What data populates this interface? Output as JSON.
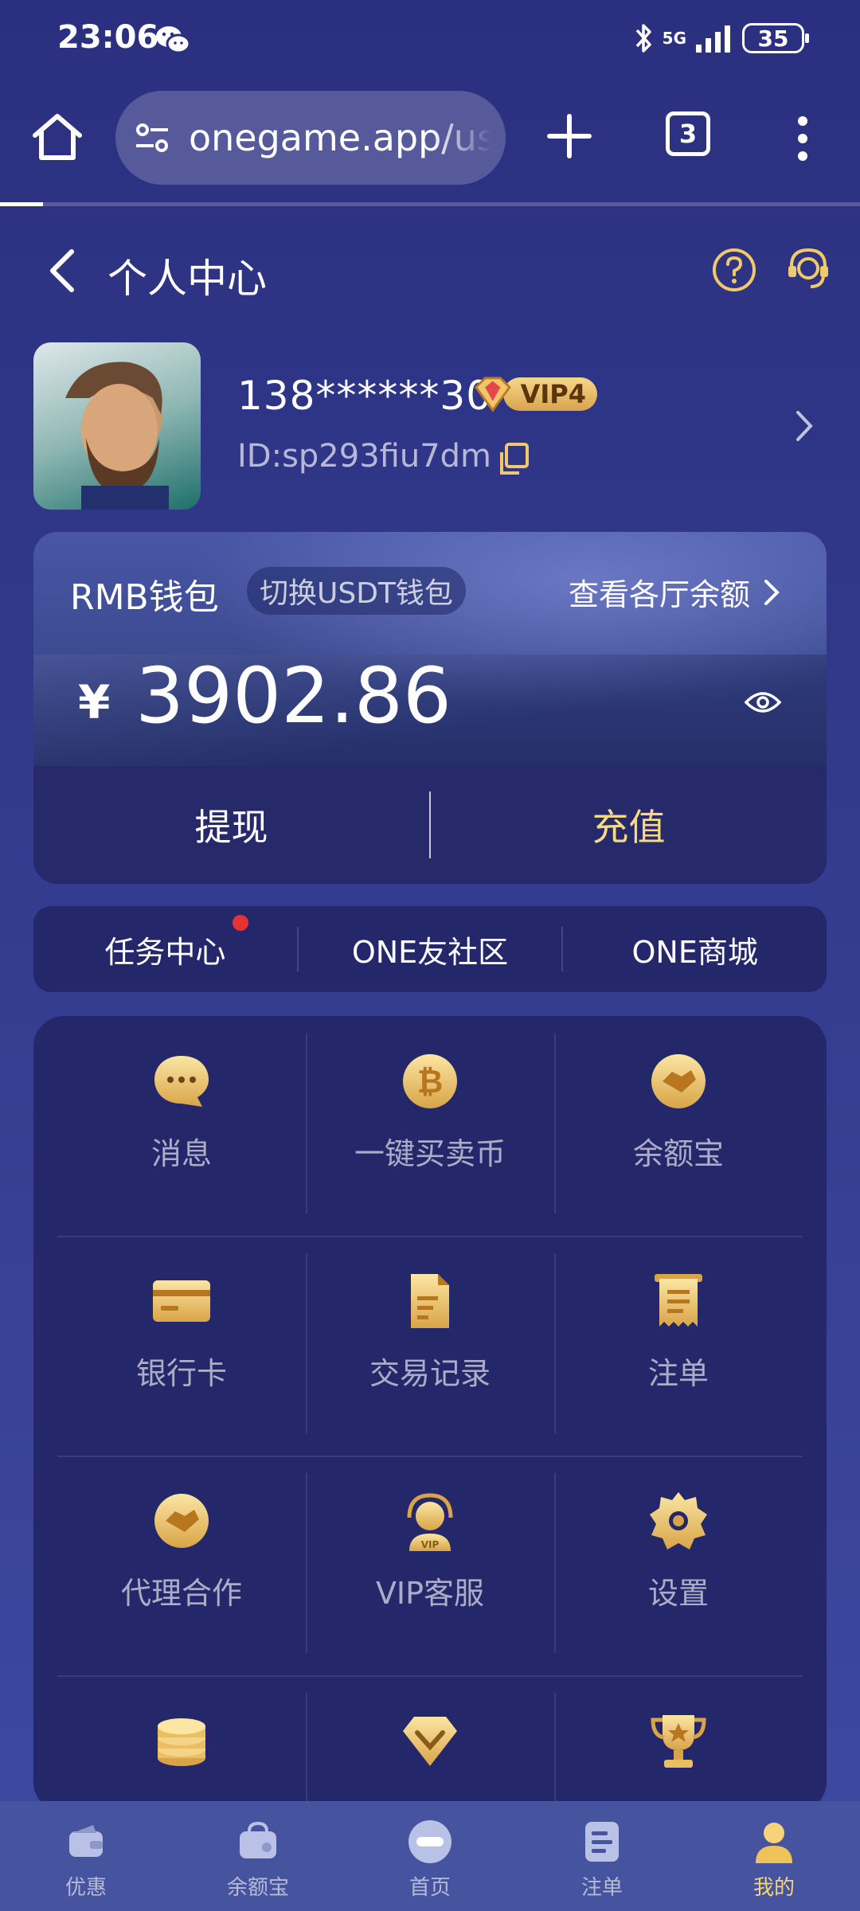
{
  "status_bar": {
    "time": "23:06",
    "network": "5G",
    "battery": "35"
  },
  "browser": {
    "url": "onegame.app/us",
    "tab_count": "3",
    "load_progress": 0.05
  },
  "header": {
    "title": "个人中心"
  },
  "profile": {
    "phone": "138******30",
    "vip_level": "VIP4",
    "user_id": "ID:sp293fiu7dm"
  },
  "wallet": {
    "name": "RMB钱包",
    "switch_label": "切换USDT钱包",
    "view_all_label": "查看各厅余额",
    "currency_symbol": "¥",
    "balance": "3902.86",
    "withdraw_label": "提现",
    "recharge_label": "充值"
  },
  "quick_links": [
    {
      "label": "任务中心",
      "has_dot": true
    },
    {
      "label": "ONE友社区"
    },
    {
      "label": "ONE商城"
    }
  ],
  "grid": [
    {
      "label": "消息",
      "icon": "message-icon"
    },
    {
      "label": "一键买卖币",
      "icon": "bitcoin-icon"
    },
    {
      "label": "余额宝",
      "icon": "handshake-icon"
    },
    {
      "label": "银行卡",
      "icon": "bank-card-icon"
    },
    {
      "label": "交易记录",
      "icon": "document-icon"
    },
    {
      "label": "注单",
      "icon": "receipt-icon"
    },
    {
      "label": "代理合作",
      "icon": "handshake-icon"
    },
    {
      "label": "VIP客服",
      "icon": "vip-service-icon"
    },
    {
      "label": "设置",
      "icon": "gear-icon"
    },
    {
      "label": "",
      "icon": "coins-stack-icon"
    },
    {
      "label": "",
      "icon": "diamond-icon"
    },
    {
      "label": "",
      "icon": "trophy-icon"
    }
  ],
  "bottom_nav": [
    {
      "label": "优惠",
      "icon": "wallet-icon"
    },
    {
      "label": "余额宝",
      "icon": "purse-icon"
    },
    {
      "label": "首页",
      "icon": "home-logo-icon"
    },
    {
      "label": "注单",
      "icon": "list-icon"
    },
    {
      "label": "我的",
      "icon": "user-icon",
      "active": true
    }
  ],
  "colors": {
    "background": "#2b2f7f",
    "card": "#242769",
    "gold": "#f6d37a",
    "accent_red": "#e63232"
  }
}
